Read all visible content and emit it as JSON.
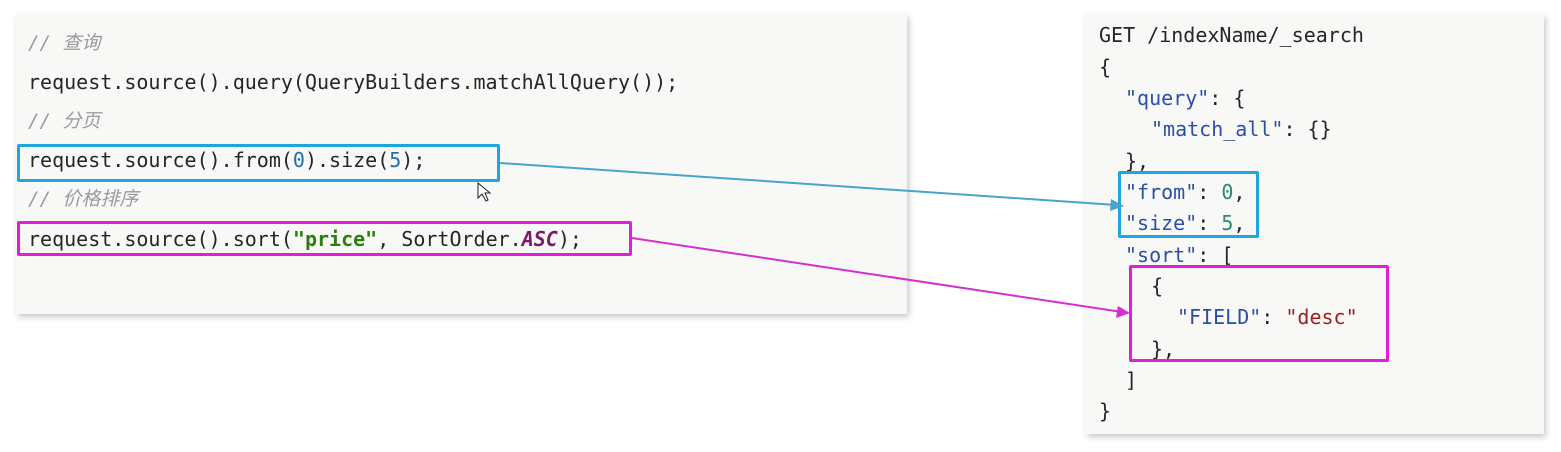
{
  "left_code": {
    "comment_query": "// 查询",
    "line_query": "request.source().query(QueryBuilders.matchAllQuery());",
    "comment_paging": "// 分页",
    "line_paging": {
      "prefix": "request.source().from(",
      "from_value": "0",
      "middle": ").size(",
      "size_value": "5",
      "suffix": ");"
    },
    "comment_sort": "// 价格排序",
    "line_sort": {
      "prefix": "request.source().sort(",
      "field": "\"price\"",
      "middle": ", SortOrder.",
      "order": "ASC",
      "suffix": ");"
    }
  },
  "right_code": {
    "request_line": "GET /indexName/_search",
    "open_brace": "{",
    "query_key": "\"query\"",
    "query_open": ": {",
    "match_all_key": "\"match_all\"",
    "match_all_value": ": {}",
    "query_close": "},",
    "from_key": "\"from\"",
    "from_value": "0",
    "size_key": "\"size\"",
    "size_value": "5",
    "sort_key": "\"sort\"",
    "sort_open": ": [",
    "sort_obj_open": "{",
    "field_key": "\"FIELD\"",
    "field_value": "\"desc\"",
    "sort_obj_close": "},",
    "sort_close": "]",
    "close_brace": "}"
  },
  "colors": {
    "paging_highlight": "#1ea7dd",
    "sort_highlight": "#e21fd8",
    "panel_background": "#f8f8f6"
  }
}
